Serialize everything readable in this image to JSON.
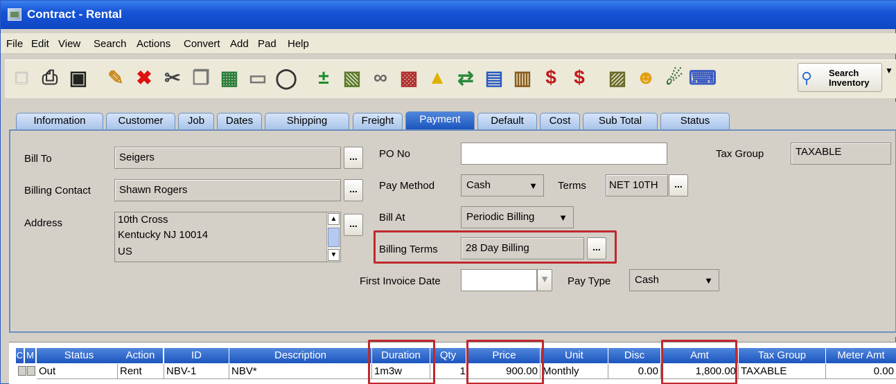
{
  "window": {
    "title": "Contract - Rental"
  },
  "menu": [
    "File",
    "Edit",
    "View",
    "Search",
    "Actions",
    "Convert",
    "Add",
    "Pad",
    "Help"
  ],
  "toolbar": {
    "icons": [
      "new-document-icon",
      "print-icon",
      "save-icon",
      "edit-pencil-icon",
      "delete-x-icon",
      "cut-scissors-icon",
      "copy-icon",
      "paste-icon",
      "document-icon",
      "binoculars-icon",
      "plus-minus-icon",
      "calculator-icon",
      "group-icon",
      "blocks-icon",
      "truck-icon",
      "transfer-icon",
      "notepad-icon",
      "building-icon",
      "pay-icon",
      "due-icon",
      "clipboard-icon",
      "worker-icon",
      "satellite-icon",
      "keyboard-icon"
    ],
    "search_inventory": "Search Inventory"
  },
  "tabs": [
    "Information",
    "Customer",
    "Job",
    "Dates",
    "Shipping",
    "Freight",
    "Payment",
    "Default",
    "Cost",
    "Sub Total",
    "Status"
  ],
  "active_tab": "Payment",
  "form": {
    "bill_to_label": "Bill To",
    "bill_to": "Seigers",
    "billing_contact_label": "Billing Contact",
    "billing_contact": "Shawn  Rogers",
    "address_label": "Address",
    "address_lines": [
      "10th Cross",
      "Kentucky NJ 10014",
      "US"
    ],
    "po_no_label": "PO No",
    "po_no": "",
    "pay_method_label": "Pay Method",
    "pay_method": "Cash",
    "terms_label": "Terms",
    "terms": "NET 10TH",
    "bill_at_label": "Bill At",
    "bill_at": "Periodic Billing",
    "billing_terms_label": "Billing Terms",
    "billing_terms": "28 Day Billing",
    "first_invoice_date_label": "First Invoice Date",
    "first_invoice_date": "",
    "pay_type_label": "Pay Type",
    "pay_type": "Cash",
    "tax_group_label": "Tax Group",
    "tax_group": "TAXABLE",
    "ellipsis": "..."
  },
  "grid": {
    "headers": [
      "C",
      "M",
      "Status",
      "Action",
      "ID",
      "Description",
      "Duration",
      "Qty",
      "Price",
      "Unit",
      "Disc",
      "Amt",
      "Tax Group",
      "Meter Amt"
    ],
    "rows": [
      {
        "status": "Out",
        "action": "Rent",
        "id": "NBV-1",
        "description": "NBV*",
        "duration": "1m3w",
        "qty": "1",
        "price": "900.00",
        "unit": "Monthly",
        "disc": "0.00",
        "amt": "1,800.00",
        "tax_group": "TAXABLE",
        "meter_amt": "0.00"
      }
    ]
  },
  "colors": {
    "highlight": "#c0282d",
    "tab_active": "#1c55bf",
    "titlebar": "#1654d6"
  }
}
